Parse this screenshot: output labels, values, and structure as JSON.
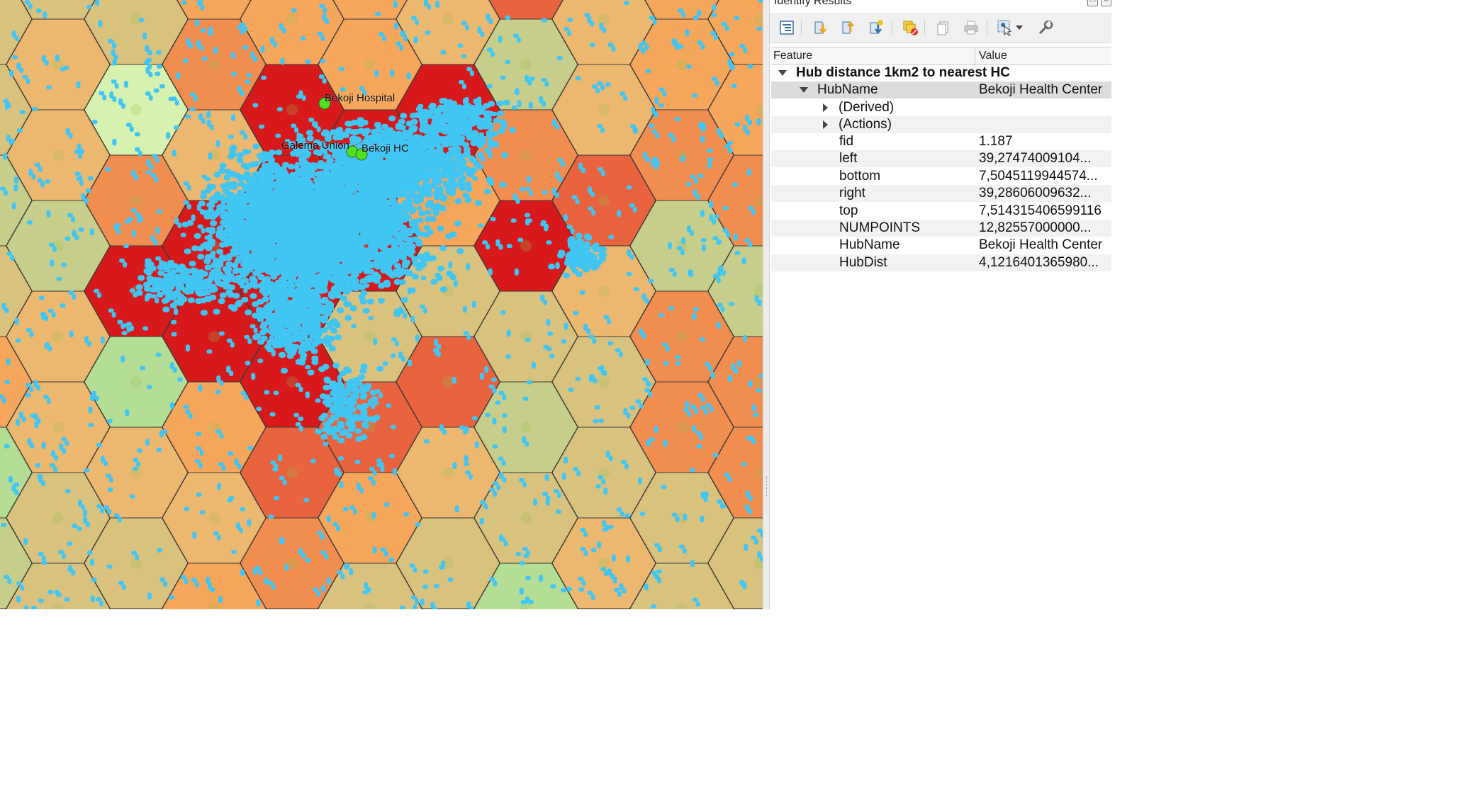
{
  "panel": {
    "title": "Identify Results",
    "columns": {
      "feature": "Feature",
      "value": "Value"
    },
    "layer_name": "Hub distance 1km2 to nearest HC",
    "root_feature": {
      "name": "HubName",
      "value": "Bekoji Health Center"
    },
    "groups": [
      "(Derived)",
      "(Actions)"
    ],
    "attributes": [
      {
        "name": "fid",
        "value": "1.187"
      },
      {
        "name": "left",
        "value": "39,27474009104..."
      },
      {
        "name": "bottom",
        "value": "7,5045119944574..."
      },
      {
        "name": "right",
        "value": "39,28606009632..."
      },
      {
        "name": "top",
        "value": "7,514315406599116"
      },
      {
        "name": "NUMPOINTS",
        "value": "12,82557000000..."
      },
      {
        "name": "HubName",
        "value": "Bekoji Health Center"
      },
      {
        "name": "HubDist",
        "value": "4,1216401365980..."
      }
    ],
    "toolbar_icons": [
      "expand-tree-icon",
      "expand-all-icon",
      "collapse-all-icon",
      "expand-new-icon",
      "clear-results-icon",
      "copy-feature-icon",
      "print-icon",
      "identify-mode-icon",
      "settings-icon"
    ]
  },
  "map": {
    "labels": {
      "hospital": "Bekoji Hospital",
      "union": "Galema Union",
      "hc": "Bekoji HC"
    },
    "colors": {
      "point_fill": "#41c6f4",
      "facility_fill": "#4ee021",
      "ramp": [
        "#d7f2b0",
        "#b4dd96",
        "#c7cd8a",
        "#d9c27e",
        "#ecb76f",
        "#f6a75c",
        "#f28d50",
        "#e9633f",
        "#d7191c"
      ]
    }
  }
}
